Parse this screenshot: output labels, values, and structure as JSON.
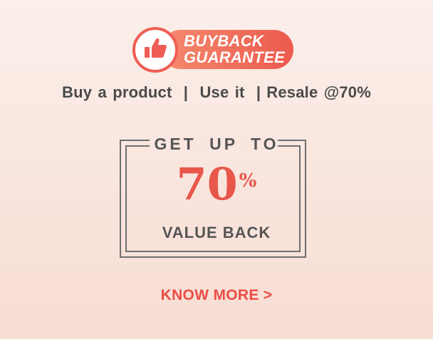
{
  "badge": {
    "line1": "BUYBACK",
    "line2": "GUARANTEE",
    "icon": "thumbs-up-icon",
    "colors": {
      "pill_start": "#f48a6e",
      "pill_end": "#ec5a4e",
      "ring": "#ef5e54"
    }
  },
  "tagline": {
    "part1": "Buy a product",
    "sep1": "|",
    "part2": "Use it",
    "sep2": "|",
    "part3": "Resale @70%"
  },
  "offer": {
    "heading": "GET UP TO",
    "value": "70",
    "unit": "%",
    "subheading": "VALUE BACK",
    "accent": "#e8574b"
  },
  "cta": {
    "label": "KNOW MORE >"
  }
}
